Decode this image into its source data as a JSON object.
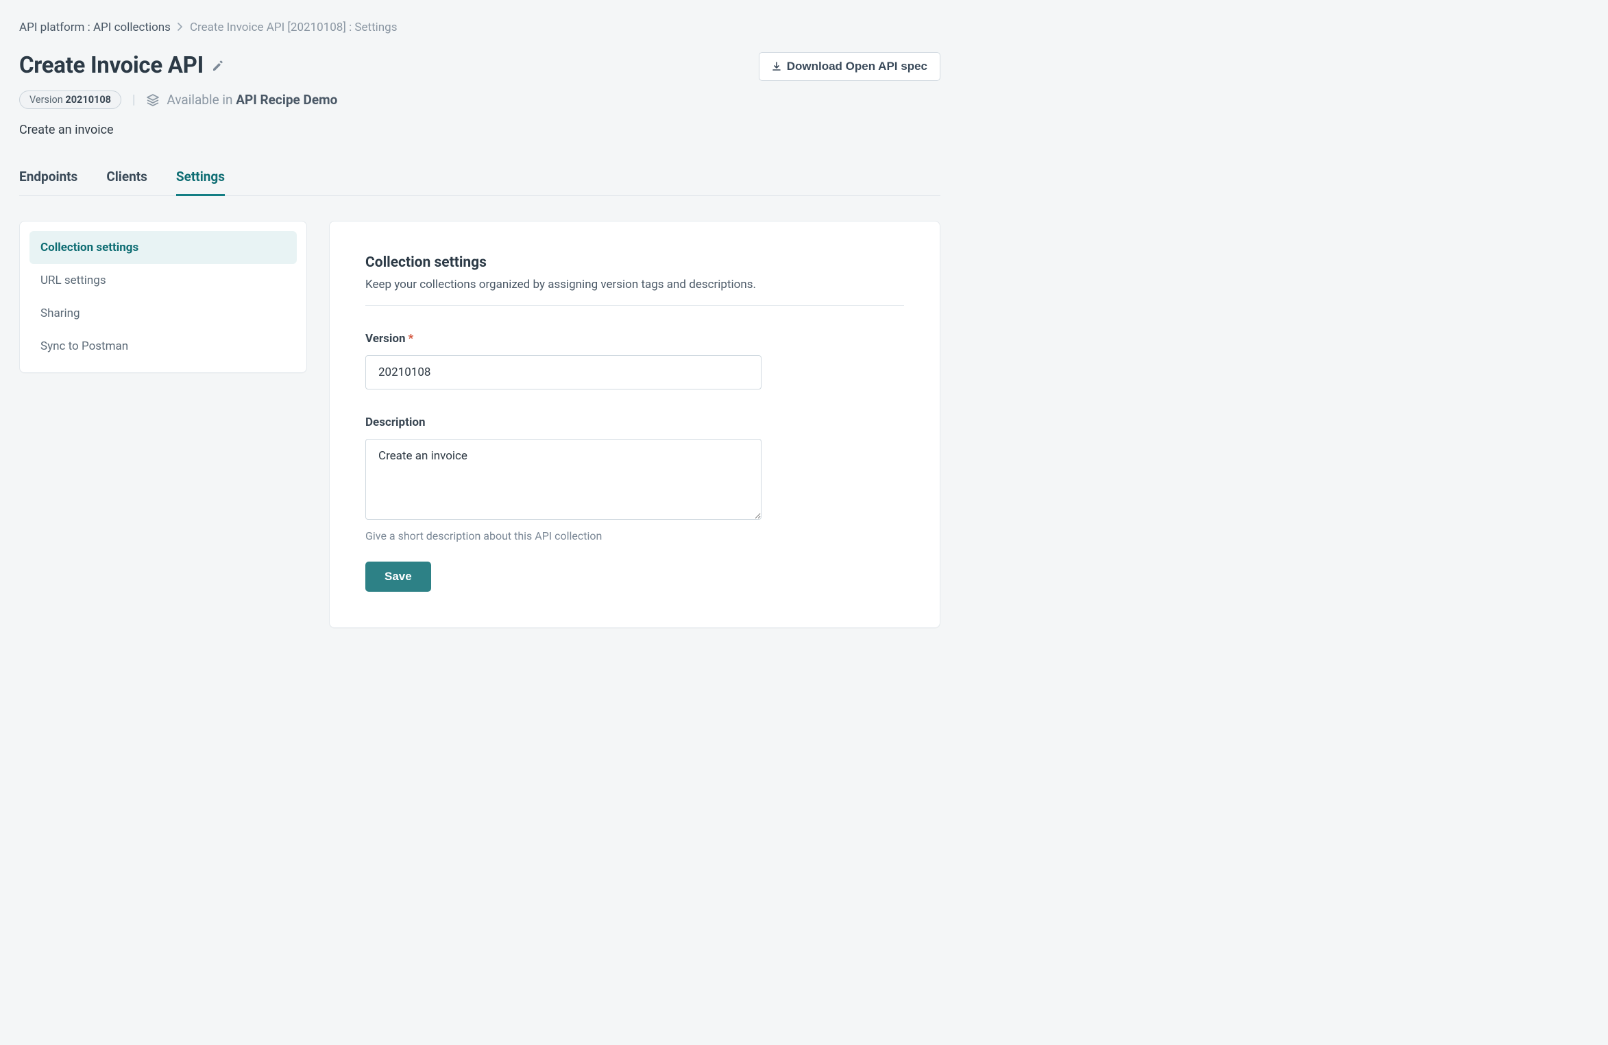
{
  "breadcrumb": {
    "root_label": "API platform : API collections",
    "current_label": "Create Invoice API [20210108] : Settings"
  },
  "header": {
    "title": "Create Invoice API",
    "download_label": "Download Open API spec"
  },
  "meta": {
    "version_prefix": "Version ",
    "version_value": "20210108",
    "available_prefix": "Available in ",
    "available_target": "API Recipe Demo"
  },
  "short_description": "Create an invoice",
  "tabs": [
    {
      "label": "Endpoints",
      "active": false
    },
    {
      "label": "Clients",
      "active": false
    },
    {
      "label": "Settings",
      "active": true
    }
  ],
  "sidebar": {
    "items": [
      {
        "label": "Collection settings",
        "active": true
      },
      {
        "label": "URL settings",
        "active": false
      },
      {
        "label": "Sharing",
        "active": false
      },
      {
        "label": "Sync to Postman",
        "active": false
      }
    ]
  },
  "panel": {
    "title": "Collection settings",
    "subtitle": "Keep your collections organized by assigning version tags and descriptions.",
    "version_label": "Version",
    "version_value": "20210108",
    "description_label": "Description",
    "description_value": "Create an invoice",
    "description_help": "Give a short description about this API collection",
    "save_label": "Save"
  }
}
